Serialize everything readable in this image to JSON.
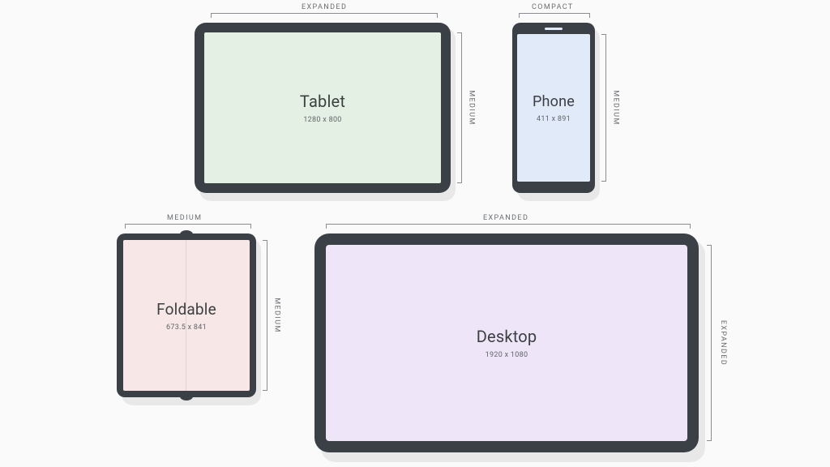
{
  "devices": {
    "tablet": {
      "name": "Tablet",
      "resolution": "1280 x 800",
      "width_class": "EXPANDED",
      "height_class": "MEDIUM",
      "screen_color": "#e4f0e4"
    },
    "phone": {
      "name": "Phone",
      "resolution": "411 x 891",
      "width_class": "COMPACT",
      "height_class": "MEDIUM",
      "screen_color": "#e0eaf8"
    },
    "foldable": {
      "name": "Foldable",
      "resolution": "673.5 x 841",
      "width_class": "MEDIUM",
      "height_class": "MEDIUM",
      "screen_color": "#f7e7e7"
    },
    "desktop": {
      "name": "Desktop",
      "resolution": "1920 x 1080",
      "width_class": "EXPANDED",
      "height_class": "EXPANDED",
      "screen_color": "#eee5f8"
    }
  }
}
